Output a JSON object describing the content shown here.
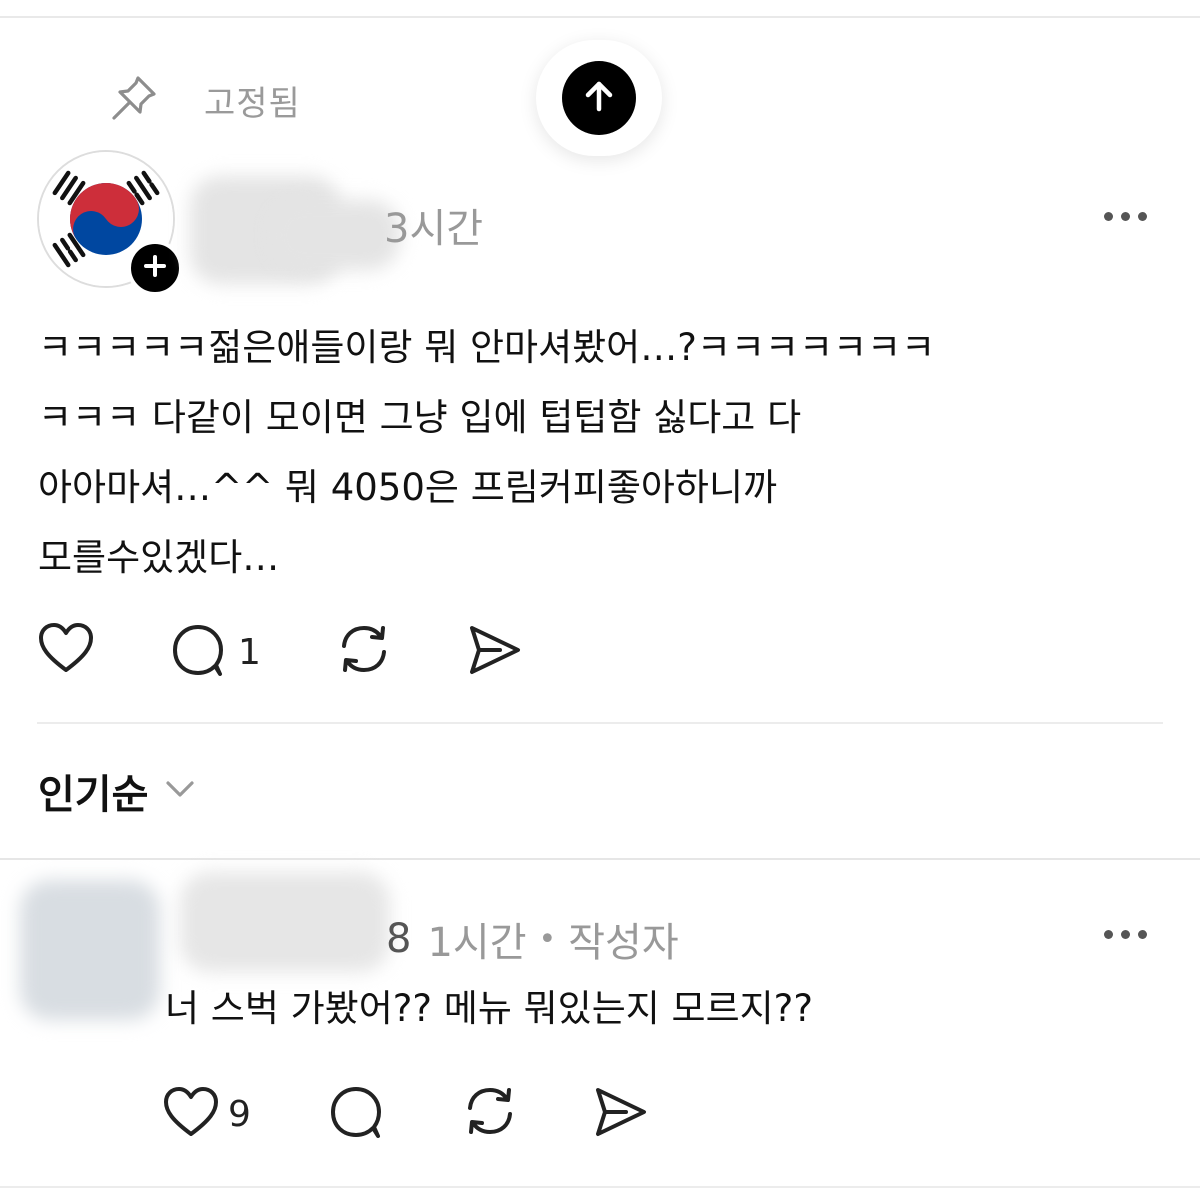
{
  "pinned": {
    "label": "고정됨"
  },
  "post": {
    "time": "3시간",
    "body_lines": [
      "ㅋㅋㅋㅋㅋ젊은애들이랑 뭐 안마셔봤어…?ㅋㅋㅋㅋㅋㅋㅋ",
      "ㅋㅋㅋ 다같이 모이면 그냥 입에 텁텁함 싫다고 다",
      "아아마셔…^^ 뭐 4050은 프림커피좋아하니까",
      "모를수있겠다…"
    ],
    "comment_count": "1"
  },
  "sort": {
    "label": "인기순"
  },
  "reply": {
    "name_tail": "8",
    "time": "1시간",
    "separator": "•",
    "author_badge": "작성자",
    "text": "너 스벅 가봤어?? 메뉴 뭐있는지 모르지??",
    "like_count": "9"
  },
  "colors": {
    "flag_red": "#cd2e3a",
    "flag_blue": "#0047a0",
    "meta_gray": "#999999"
  },
  "icons": [
    "pin-icon",
    "arrow-up-icon",
    "plus-icon",
    "more-icon",
    "heart-icon",
    "comment-icon",
    "repost-icon",
    "share-icon",
    "chevron-down-icon"
  ]
}
